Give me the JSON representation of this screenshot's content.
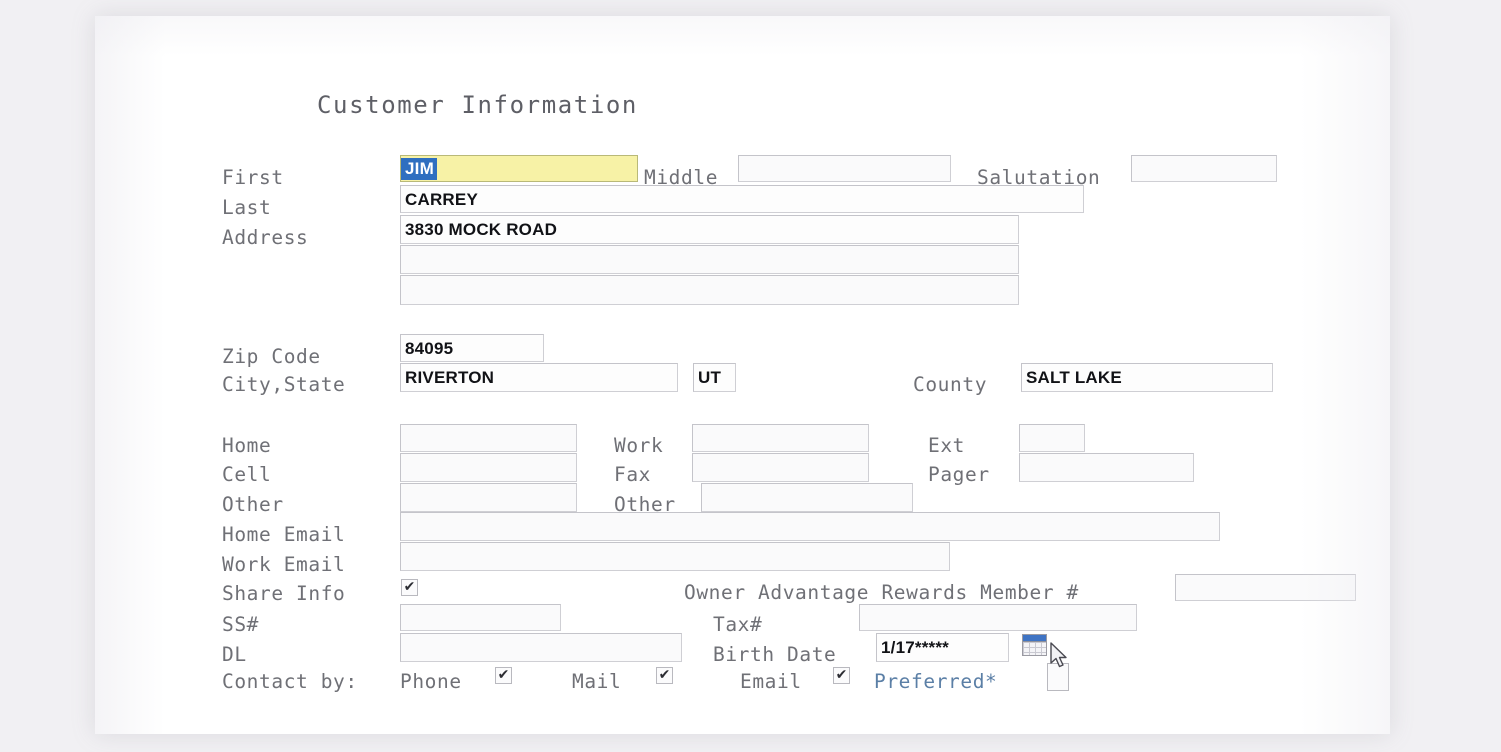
{
  "window": {
    "title": "Customer Information"
  },
  "colors": {
    "page_background": "#f1f0f3",
    "panel_background": "#ffffff",
    "label_text": "#6f7076",
    "value_text": "#111216",
    "active_field_background": "#f7f2a6",
    "selection_background": "#2f6fc0",
    "preferred_link": "#5b7fa6",
    "calendar_header": "#3f74c4"
  },
  "section": {
    "heading": "Customer Information"
  },
  "name_row": {
    "first_label": "First",
    "first_value": "JIM",
    "first_selected": "JIM",
    "middle_label": "Middle",
    "middle_value": "",
    "salutation_label": "Salutation",
    "salutation_value": "",
    "last_label": "Last",
    "last_value": "CARREY"
  },
  "address": {
    "label": "Address",
    "line1": "3830 MOCK ROAD",
    "line2": "",
    "line3": ""
  },
  "location": {
    "zip_label": "Zip Code",
    "zip_value": "84095",
    "city_state_label": "City,State",
    "city_value": "RIVERTON",
    "state_value": "UT",
    "county_label": "County",
    "county_value": "SALT LAKE"
  },
  "phones": {
    "home_label": "Home",
    "home_value": "",
    "cell_label": "Cell",
    "cell_value": "",
    "other_left_label": "Other",
    "other_left_value": "",
    "work_label": "Work",
    "work_value": "",
    "fax_label": "Fax",
    "fax_value": "",
    "other_right_label": "Other",
    "other_right_value": "",
    "ext_label": "Ext",
    "ext_value": "",
    "pager_label": "Pager",
    "pager_value": ""
  },
  "emails": {
    "home_email_label": "Home Email",
    "home_email_value": "",
    "work_email_label": "Work Email",
    "work_email_value": ""
  },
  "misc": {
    "share_info_label": "Share Info",
    "share_info_checked": true,
    "share_info_mark": "✔",
    "rewards_label": "Owner Advantage Rewards Member #",
    "rewards_value": "",
    "ss_label": "SS#",
    "ss_value": "",
    "tax_label": "Tax#",
    "tax_value": "",
    "dl_label": "DL",
    "dl_value": "",
    "birth_date_label": "Birth Date",
    "birth_date_value": "1/17*****",
    "calendar_icon": "calendar-icon"
  },
  "contact_by": {
    "label": "Contact by:",
    "phone_label": "Phone",
    "phone_checked": true,
    "phone_mark": "✔",
    "mail_label": "Mail",
    "mail_checked": true,
    "mail_mark": "✔",
    "email_label": "Email",
    "email_checked": true,
    "email_mark": "✔",
    "preferred_label": "Preferred*",
    "preferred_checked": false,
    "preferred_mark": ""
  }
}
